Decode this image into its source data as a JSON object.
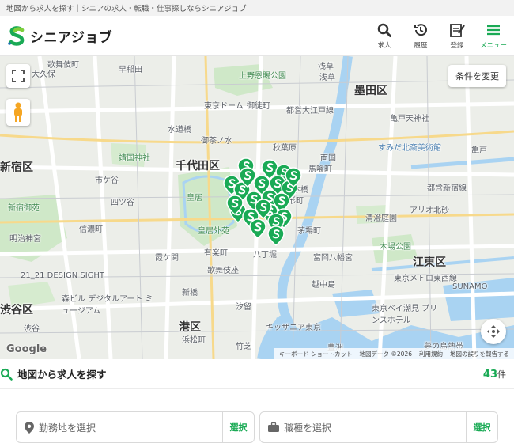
{
  "topbar": {
    "text": "地図から求人を探す｜シニアの求人・転職・仕事探しならシニアジョブ"
  },
  "header": {
    "logo_text": "シニアジョブ",
    "nav": [
      {
        "label": "求人",
        "icon": "search-icon"
      },
      {
        "label": "履歴",
        "icon": "history-icon"
      },
      {
        "label": "登録",
        "icon": "register-icon"
      },
      {
        "label": "メニュー",
        "icon": "menu-icon"
      }
    ]
  },
  "map": {
    "condition_button": "条件を変更",
    "google": "Google",
    "attribution": {
      "shortcuts": "キーボード ショートカット",
      "data": "地図データ ©2026",
      "terms": "利用規約",
      "report": "地図の誤りを報告する"
    },
    "labels": {
      "kabukicho": "歌舞伎町",
      "sentai": "大久保",
      "waseda": "早稲田",
      "ueno_park": "上野恩賜公園",
      "asakusa": "浅草",
      "asakusa_stn": "浅草",
      "sumida": "墨田区",
      "tokyo_dome": "東京ドーム",
      "okachimachi": "御徒町",
      "oedo": "都営大江戸線",
      "kameido": "亀戸",
      "kameido_tenjin": "亀戸天神社",
      "shinjuku_ku": "新宿区",
      "chiyoda": "千代田区",
      "suidobashi": "水道橋",
      "ochanomizu": "御茶ノ水",
      "akihabara": "秋葉原",
      "ryogoku": "両国",
      "hokusai": "すみだ北斎美術館",
      "yasukuni": "靖国神社",
      "ichigaya": "市ケ谷",
      "bakurocho": "馬喰町",
      "nihonbashi": "日本橋",
      "ningyocho": "人形町",
      "shinjuku_line": "都営新宿線",
      "shinjuku_gyoen": "新宿御苑",
      "yotsuya": "四ツ谷",
      "kokyo": "皇居",
      "ario": "アリオ北砂",
      "shinanomachi": "信濃町",
      "meiji": "明治神宮",
      "kokyo_gaien": "皇居外苑",
      "kiyosumi": "清澄庭園",
      "kayabacho": "茅場町",
      "kiba": "木場公園",
      "kasumigaseki": "霞ケ関",
      "yurakucho": "有楽町",
      "hatchobori": "八丁堀",
      "monzen": "富岡八幡宮",
      "koto": "江東区",
      "tozai": "東京メトロ東西線",
      "dsight": "21_21 DESIGN SIGHT",
      "kabukiza": "歌舞伎座",
      "shibuya_ku": "渋谷区",
      "mori": "森ビル デジタルアート ミュージアム",
      "shimbashi": "新橋",
      "shiodome": "汐留",
      "etchujima": "越中島",
      "sunamo": "SUNAMO",
      "shibuya": "渋谷",
      "minato": "港区",
      "kidzania": "キッザニア東京",
      "hamamatsucho": "浜松町",
      "takeshiba": "竹芝",
      "toyosu": "豊洲",
      "bay": "東京ベイ潮見 プリンスホテル",
      "yumenoshima": "夢の島熱帯"
    },
    "pins": 22
  },
  "search": {
    "title": "地図から求人を探す",
    "count": "43",
    "count_unit": "件"
  },
  "selects": [
    {
      "placeholder": "勤務地を選択",
      "button": "選択",
      "icon": "location-pin-icon"
    },
    {
      "placeholder": "職種を選択",
      "button": "選択",
      "icon": "briefcase-icon"
    }
  ],
  "colors": {
    "brand": "#1aaa55",
    "water": "#a9d3f2",
    "park": "#cfe8c8"
  }
}
